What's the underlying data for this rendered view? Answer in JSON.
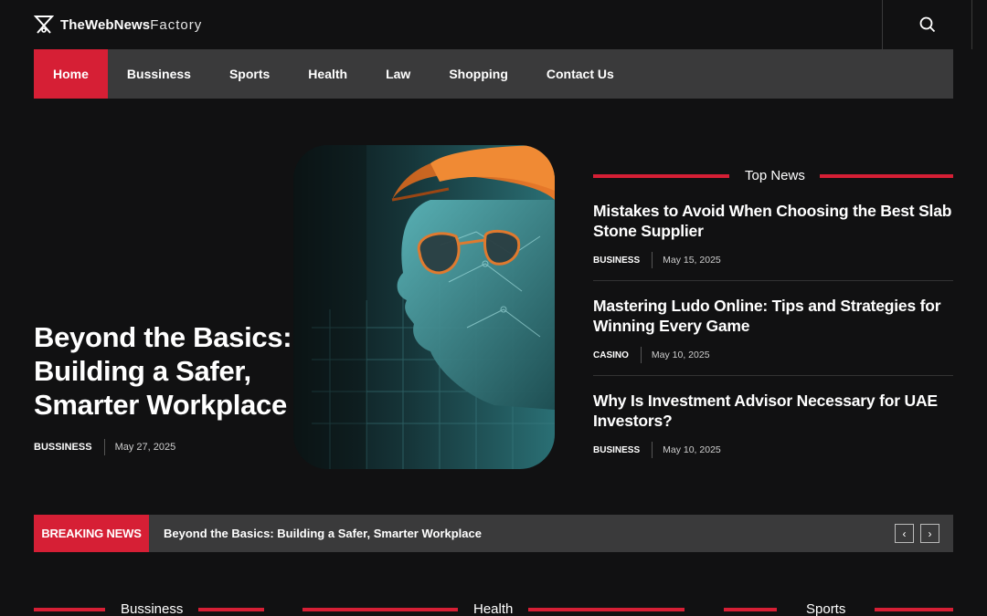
{
  "header": {
    "logo_bold": "TheWebNews",
    "logo_thin": "Factory",
    "search_icon": "search-icon"
  },
  "nav": {
    "items": [
      {
        "label": "Home",
        "active": true
      },
      {
        "label": "Bussiness"
      },
      {
        "label": "Sports"
      },
      {
        "label": "Health"
      },
      {
        "label": "Law"
      },
      {
        "label": "Shopping"
      },
      {
        "label": "Contact Us"
      }
    ]
  },
  "hero": {
    "title": "Beyond the Basics: Building a Safer, Smarter Workplace",
    "category": "BUSSINESS",
    "date": "May 27, 2025"
  },
  "top_news": {
    "heading": "Top News",
    "items": [
      {
        "title": "Mistakes to Avoid When Choosing the Best Slab Stone Supplier",
        "category": "BUSINESS",
        "date": "May 15, 2025"
      },
      {
        "title": "Mastering Ludo Online: Tips and Strategies for Winning Every Game",
        "category": "CASINO",
        "date": "May 10, 2025"
      },
      {
        "title": "Why Is Investment Advisor Necessary for UAE Investors?",
        "category": "BUSINESS",
        "date": "May 10, 2025"
      }
    ]
  },
  "breaking": {
    "label": "BREAKING NEWS",
    "text": "Beyond the Basics: Building a Safer, Smarter Workplace",
    "prev": "‹",
    "next": "›"
  },
  "sections": {
    "bussiness": "Bussiness",
    "health": "Health",
    "sports": "Sports"
  },
  "colors": {
    "accent": "#d61f35",
    "background": "#111112",
    "nav_bg": "#3a3a3b"
  }
}
